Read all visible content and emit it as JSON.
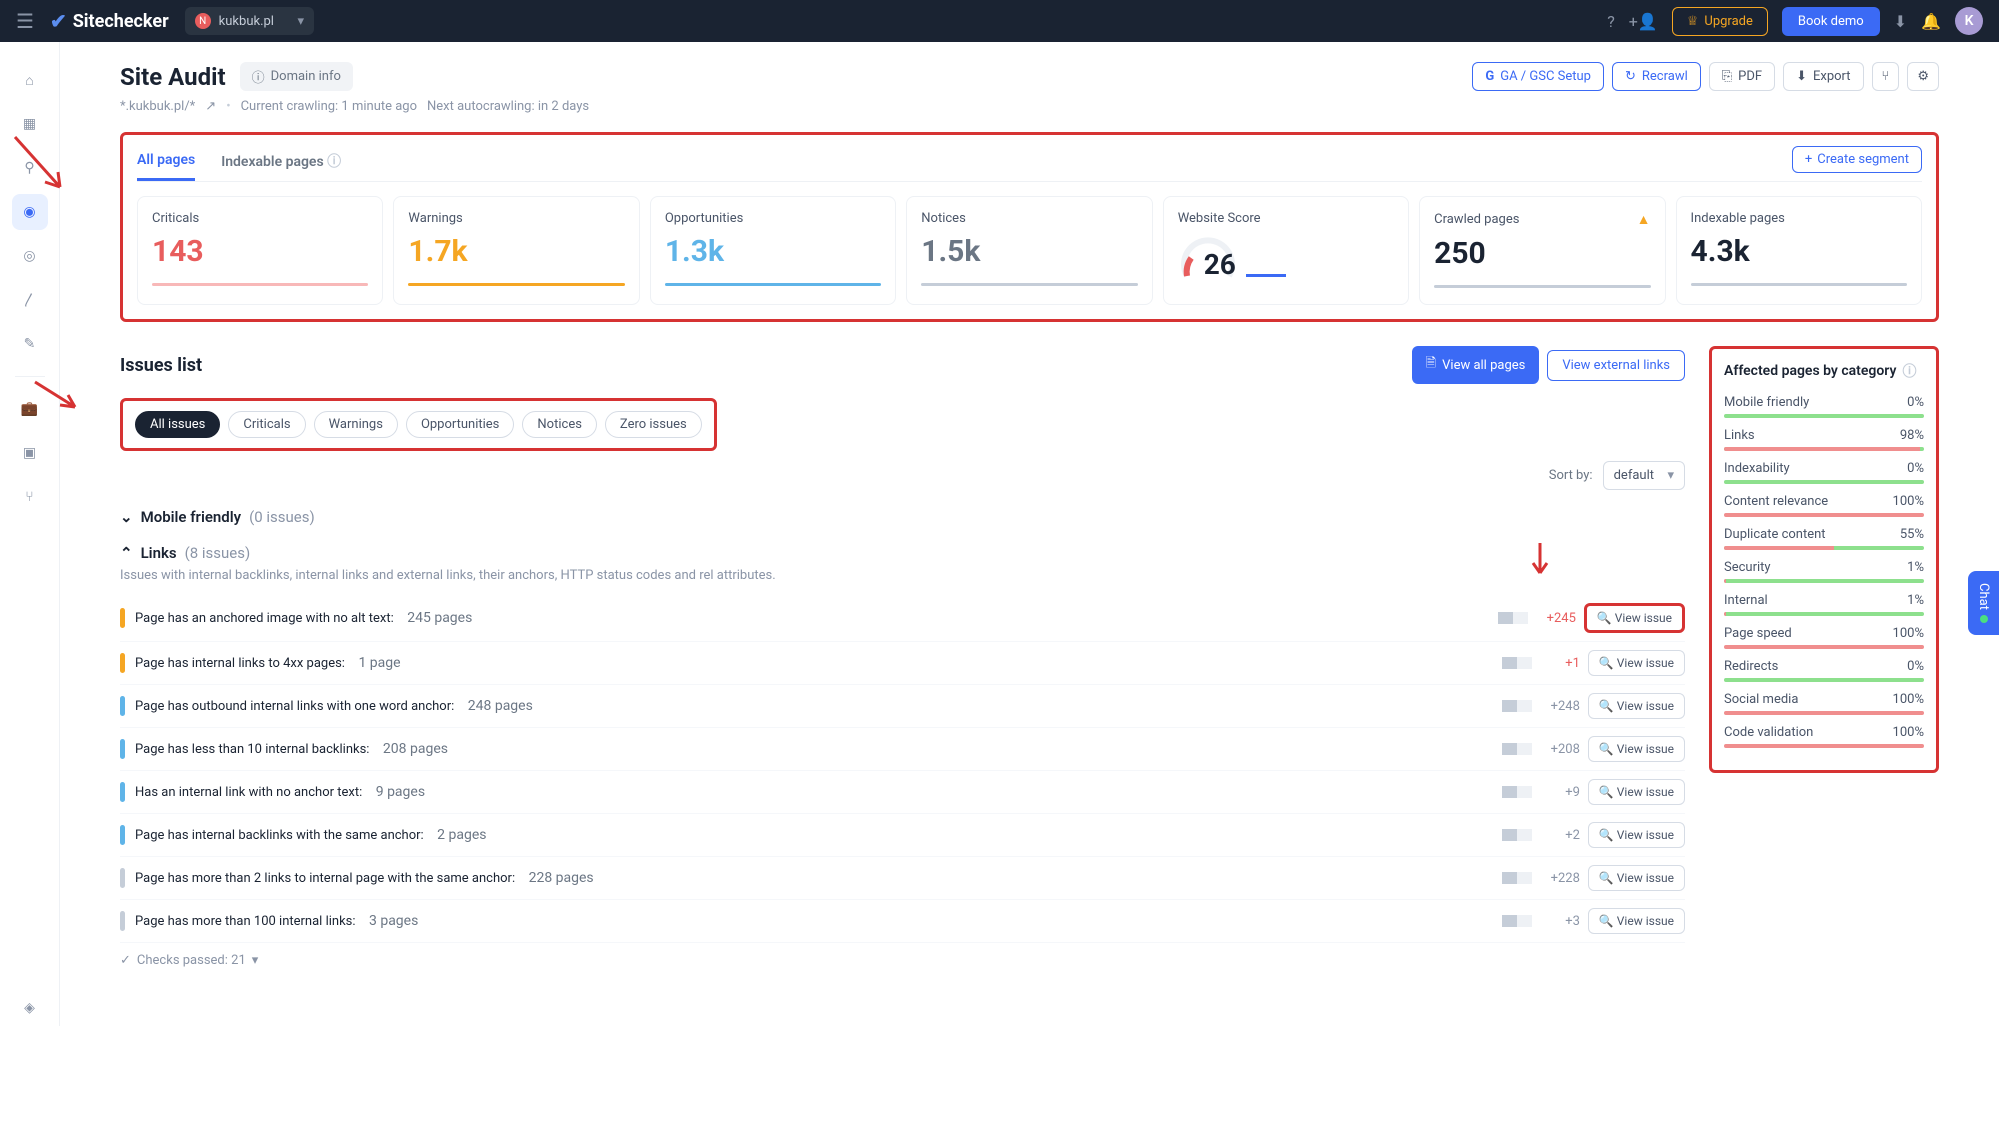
{
  "topbar": {
    "brand": "Sitechecker",
    "site": "kukbuk.pl",
    "upgrade": "Upgrade",
    "book": "Book demo",
    "avatar": "K"
  },
  "page": {
    "title": "Site Audit",
    "domain_info": "Domain info",
    "crumb_site": "*.kukbuk.pl/*",
    "crumb_crawl": "Current crawling: 1 minute ago",
    "crumb_next": "Next autocrawling: in 2 days"
  },
  "actions": {
    "ga": "GA / GSC Setup",
    "recrawl": "Recrawl",
    "pdf": "PDF",
    "export": "Export"
  },
  "tabs": {
    "all": "All pages",
    "index": "Indexable pages",
    "create": "Create segment"
  },
  "cards": {
    "criticals": {
      "label": "Criticals",
      "val": "143"
    },
    "warnings": {
      "label": "Warnings",
      "val": "1.7k"
    },
    "opp": {
      "label": "Opportunities",
      "val": "1.3k"
    },
    "notices": {
      "label": "Notices",
      "val": "1.5k"
    },
    "score": {
      "label": "Website Score",
      "val": "26"
    },
    "crawled": {
      "label": "Crawled pages",
      "val": "250"
    },
    "indexable": {
      "label": "Indexable pages",
      "val": "4.3k"
    }
  },
  "issues": {
    "title": "Issues list",
    "view_all": "View all pages",
    "view_ext": "View external links",
    "sort_label": "Sort by:",
    "sort_val": "default"
  },
  "filters": {
    "all": "All issues",
    "crit": "Criticals",
    "warn": "Warnings",
    "opp": "Opportunities",
    "not": "Notices",
    "zero": "Zero issues"
  },
  "groups": {
    "mobile": {
      "name": "Mobile friendly",
      "count": "(0 issues)"
    },
    "links": {
      "name": "Links",
      "count": "(8 issues)",
      "desc": "Issues with internal backlinks, internal links and external links, their anchors, HTTP status codes and rel attributes."
    }
  },
  "link_issues": [
    {
      "sev": "#f5a623",
      "text": "Page has an anchored image with no alt text:",
      "cnt": "245 pages",
      "delta": "+245",
      "dcls": "red"
    },
    {
      "sev": "#f5a623",
      "text": "Page has internal links to 4xx pages:",
      "cnt": "1 page",
      "delta": "+1",
      "dcls": "red"
    },
    {
      "sev": "#5fb4e8",
      "text": "Page has outbound internal links with one word anchor:",
      "cnt": "248 pages",
      "delta": "+248",
      "dcls": "gray"
    },
    {
      "sev": "#5fb4e8",
      "text": "Page has less than 10 internal backlinks:",
      "cnt": "208 pages",
      "delta": "+208",
      "dcls": "gray"
    },
    {
      "sev": "#5fb4e8",
      "text": "Has an internal link with no anchor text:",
      "cnt": "9 pages",
      "delta": "+9",
      "dcls": "gray"
    },
    {
      "sev": "#5fb4e8",
      "text": "Page has internal backlinks with the same anchor:",
      "cnt": "2 pages",
      "delta": "+2",
      "dcls": "gray"
    },
    {
      "sev": "#c5cdd8",
      "text": "Page has more than 2 links to internal page with the same anchor:",
      "cnt": "228 pages",
      "delta": "+228",
      "dcls": "gray"
    },
    {
      "sev": "#c5cdd8",
      "text": "Page has more than 100 internal links:",
      "cnt": "3 pages",
      "delta": "+3",
      "dcls": "gray"
    }
  ],
  "view_issue": "View issue",
  "checks": "Checks passed: 21",
  "affected": {
    "title": "Affected pages by category",
    "rows": [
      {
        "name": "Mobile friendly",
        "pct": "0%",
        "fill": 0
      },
      {
        "name": "Links",
        "pct": "98%",
        "fill": 98
      },
      {
        "name": "Indexability",
        "pct": "0%",
        "fill": 0
      },
      {
        "name": "Content relevance",
        "pct": "100%",
        "fill": 100
      },
      {
        "name": "Duplicate content",
        "pct": "55%",
        "fill": 55
      },
      {
        "name": "Security",
        "pct": "1%",
        "fill": 1
      },
      {
        "name": "Internal",
        "pct": "1%",
        "fill": 1
      },
      {
        "name": "Page speed",
        "pct": "100%",
        "fill": 100
      },
      {
        "name": "Redirects",
        "pct": "0%",
        "fill": 0
      },
      {
        "name": "Social media",
        "pct": "100%",
        "fill": 100
      },
      {
        "name": "Code validation",
        "pct": "100%",
        "fill": 100
      }
    ]
  },
  "chat": "Chat"
}
